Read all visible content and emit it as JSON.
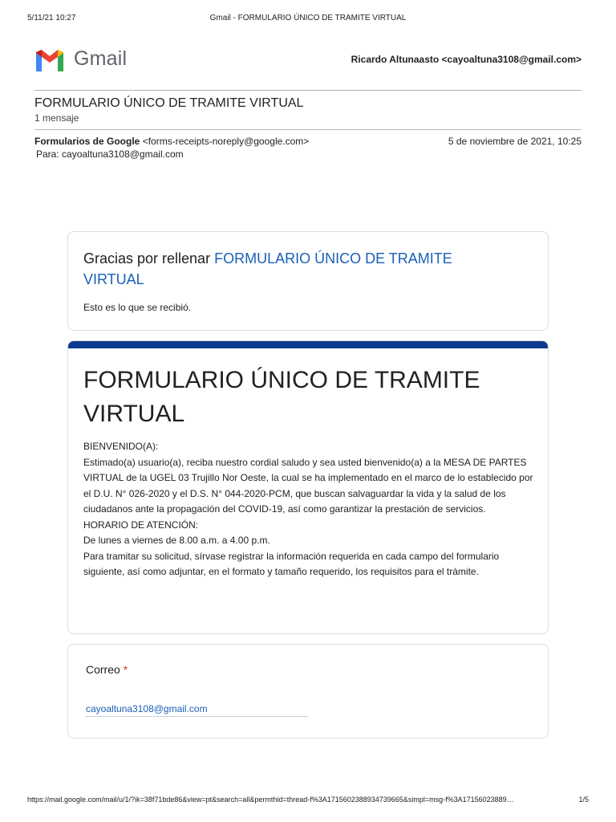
{
  "print_header": {
    "date": "5/11/21 10:27",
    "title": "Gmail - FORMULARIO ÚNICO DE TRAMITE VIRTUAL"
  },
  "app": {
    "name": "Gmail",
    "account": "Ricardo Altunaasto <cayoaltuna3108@gmail.com>"
  },
  "thread": {
    "subject": "FORMULARIO ÚNICO DE TRAMITE VIRTUAL",
    "count": "1 mensaje"
  },
  "message": {
    "sender_name": "Formularios de Google",
    "sender_email": "<forms-receipts-noreply@google.com>",
    "date": "5 de noviembre de 2021, 10:25",
    "to": "Para: cayoaltuna3108@gmail.com"
  },
  "thanks_card": {
    "prefix": "Gracias por rellenar",
    "form_link": "FORMULARIO ÚNICO DE TRAMITE VIRTUAL",
    "received": "Esto es lo que se recibió."
  },
  "form_card": {
    "title": "FORMULARIO ÚNICO DE TRAMITE VIRTUAL",
    "description": "BIENVENIDO(A):\nEstimado(a) usuario(a), reciba nuestro cordial saludo y sea usted bienvenido(a) a la MESA DE PARTES VIRTUAL de la UGEL 03 Trujillo Nor Oeste, la cual se ha implementado en el marco de lo establecido por el D.U. N° 026-2020 y el D.S. N° 044-2020-PCM, que buscan salvaguardar la vida y la salud de los ciudadanos ante la propagación del COVID-19, así como garantizar la prestación de servicios.\nHORARIO DE ATENCIÓN:\nDe lunes a viernes de 8.00 a.m. a 4.00 p.m.\nPara tramitar su solicitud, sírvase registrar la información requerida en cada campo del formulario siguiente, así como adjuntar, en el formato y tamaño requerido, los requisitos para el trámite."
  },
  "question_card": {
    "label": "Correo",
    "required_mark": "*",
    "answer": "cayoaltuna3108@gmail.com"
  },
  "print_footer": {
    "url": "https://mail.google.com/mail/u/1/?ik=38f71bde86&view=pt&search=all&permthid=thread-f%3A1715602388934739665&simpl=msg-f%3A17156023889…",
    "page": "1/5"
  },
  "colors": {
    "accent_blue": "#1a5fb4",
    "form_topbar": "#0d3a8f",
    "required_red": "#d93025"
  },
  "icons": {
    "logo": "gmail-m-logo-icon"
  }
}
